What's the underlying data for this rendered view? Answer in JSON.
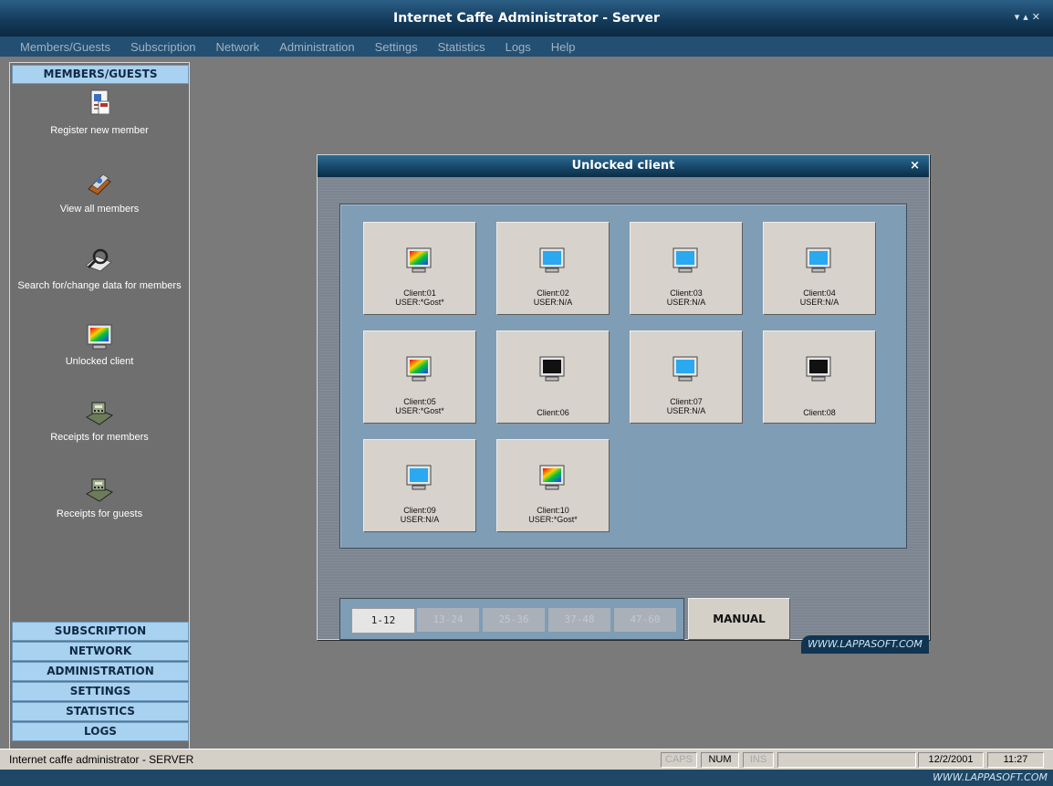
{
  "app": {
    "title": "Internet Caffe Administrator - Server"
  },
  "menu": [
    "Members/Guests",
    "Subscription",
    "Network",
    "Administration",
    "Settings",
    "Statistics",
    "Logs",
    "Help"
  ],
  "sidebar": {
    "header": "MEMBERS/GUESTS",
    "items": [
      {
        "label": "Register new member",
        "icon": "member-card-icon"
      },
      {
        "label": "View all members",
        "icon": "members-list-icon"
      },
      {
        "label": "Search for/change data for members",
        "icon": "search-magnifier-icon"
      },
      {
        "label": "Unlocked client",
        "icon": "monitor-icon"
      },
      {
        "label": "Receipts for members",
        "icon": "cash-register-icon"
      },
      {
        "label": "Receipts for guests",
        "icon": "cash-register-icon"
      }
    ],
    "categories": [
      "SUBSCRIPTION",
      "NETWORK",
      "ADMINISTRATION",
      "SETTINGS",
      "STATISTICS",
      "LOGS"
    ]
  },
  "dialog": {
    "title": "Unlocked client",
    "close": "×",
    "clients": [
      {
        "name": "Client:01",
        "user": "USER:*Gost*",
        "screen": "color"
      },
      {
        "name": "Client:02",
        "user": "USER:N/A",
        "screen": "blue"
      },
      {
        "name": "Client:03",
        "user": "USER:N/A",
        "screen": "blue"
      },
      {
        "name": "Client:04",
        "user": "USER:N/A",
        "screen": "blue"
      },
      {
        "name": "Client:05",
        "user": "USER:*Gost*",
        "screen": "color"
      },
      {
        "name": "Client:06",
        "user": "",
        "screen": "black"
      },
      {
        "name": "Client:07",
        "user": "USER:N/A",
        "screen": "blue"
      },
      {
        "name": "Client:08",
        "user": "",
        "screen": "black"
      },
      {
        "name": "Client:09",
        "user": "USER:N/A",
        "screen": "blue"
      },
      {
        "name": "Client:10",
        "user": "USER:*Gost*",
        "screen": "color"
      }
    ],
    "pages": [
      "1-12",
      "13-24",
      "25-36",
      "37-48",
      "47-60"
    ],
    "active_page": "1-12",
    "manual_label": "MANUAL",
    "brand": "WWW.LAPPASOFT.COM"
  },
  "status": {
    "text": "Internet caffe administrator - SERVER",
    "caps": "CAPS",
    "num": "NUM",
    "ins": "INS",
    "date": "12/2/2001",
    "time": "11:27"
  },
  "footer": {
    "brand": "WWW.LAPPASOFT.COM"
  },
  "colors": {
    "titlebar": "#143c5c",
    "sidebar_header": "#a9d1f0",
    "panel": "#7f9db5"
  }
}
